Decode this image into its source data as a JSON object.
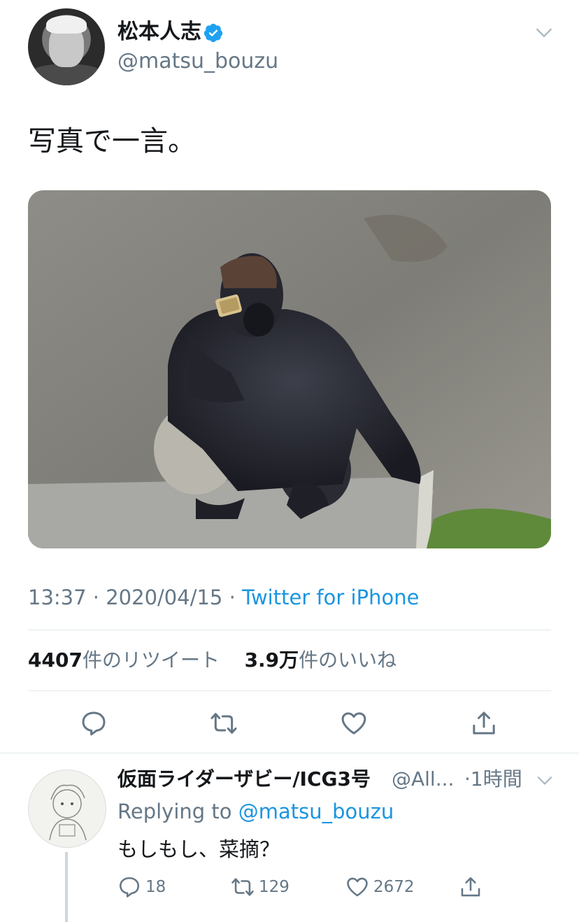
{
  "tweet": {
    "author_name": "松本人志",
    "author_handle": "@matsu_bouzu",
    "text": "写真で一言。",
    "time": "13:37",
    "date": "2020/04/15",
    "source": "Twitter for iPhone",
    "retweets_count": "4407",
    "retweets_label": "件のリツイート",
    "likes_count": "3.9万",
    "likes_label": "件のいいね",
    "separator": "·"
  },
  "reply": {
    "author_name": "仮面ライダーザビー/ICG3号",
    "author_handle": "@All...",
    "time": "1時間",
    "replying_prefix": "Replying to",
    "replying_handle": "@matsu_bouzu",
    "text": "もしもし、菜摘？",
    "reply_count": "18",
    "retweet_count": "129",
    "like_count": "2672"
  },
  "icons": {
    "verified": "verified-badge-icon",
    "chevron": "chevron-down-icon",
    "reply": "reply-icon",
    "retweet": "retweet-icon",
    "like": "heart-icon",
    "share": "share-icon"
  },
  "colors": {
    "link": "#1b95e0",
    "secondary_text": "#657786",
    "divider": "#e1e8ed"
  }
}
